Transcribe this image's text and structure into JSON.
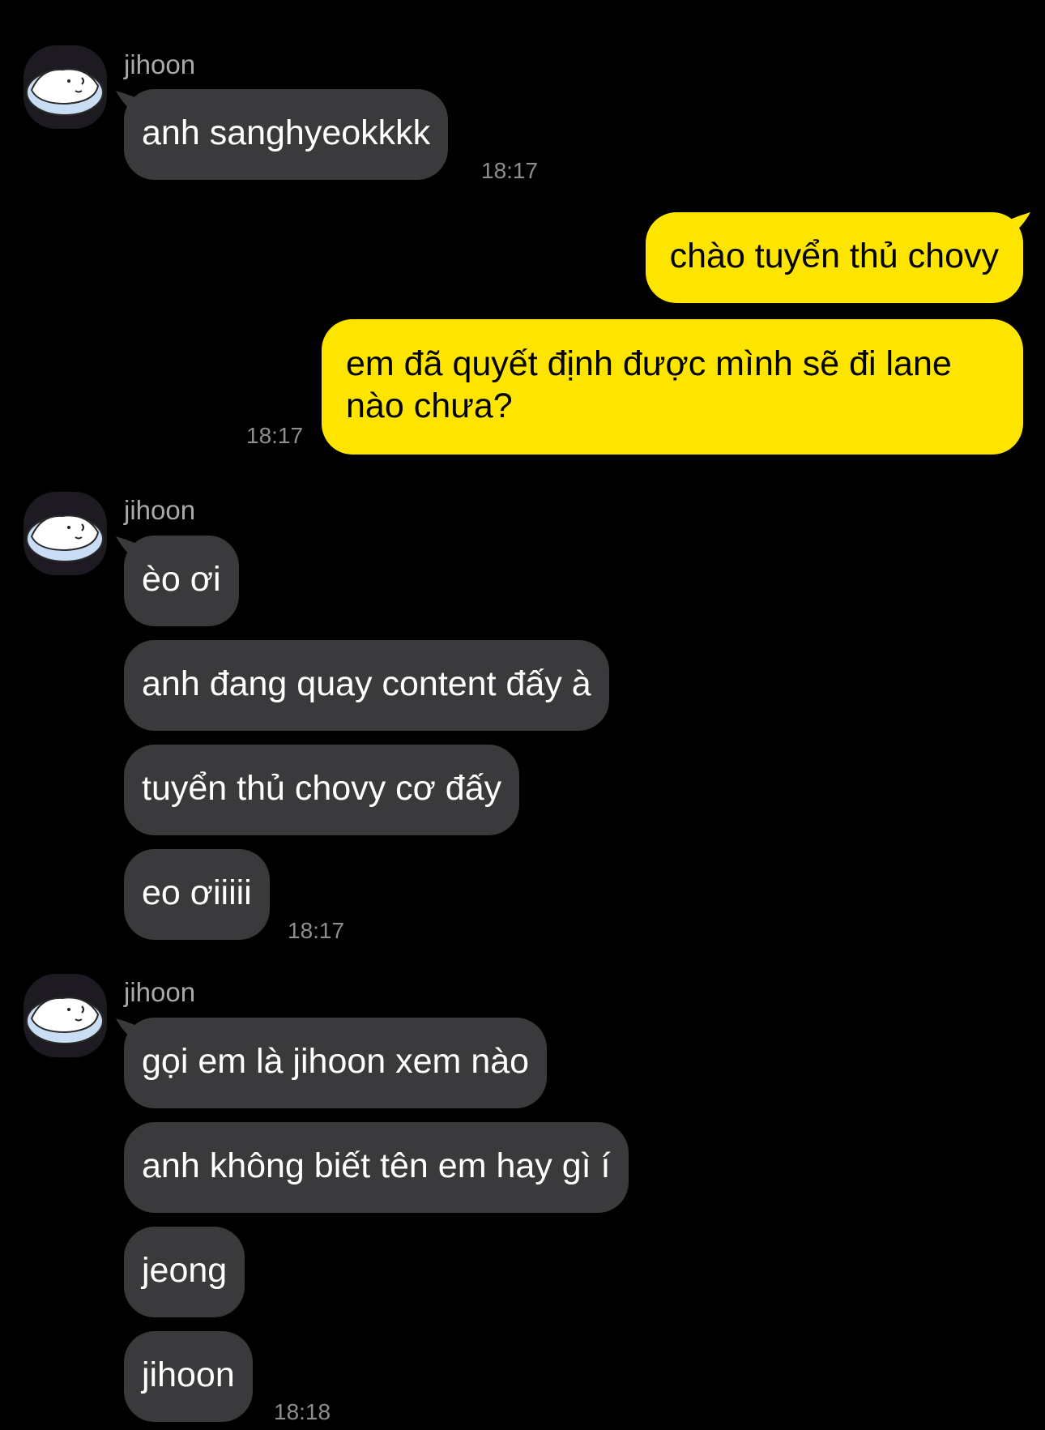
{
  "colors": {
    "background": "#000000",
    "incoming_bubble": "#3a3a3c",
    "outgoing_bubble": "#fee500",
    "sender_name": "#a9a9a9",
    "timestamp": "#8e8e8e"
  },
  "groups": [
    {
      "sender": "jihoon",
      "avatar_icon": "sleeping-blob-avatar-icon",
      "messages": [
        "anh sanghyeokkkk"
      ],
      "time": "18:17"
    },
    {
      "sender": "me",
      "messages": [
        "chào tuyển thủ chovy",
        "em đã quyết định được mình sẽ đi lane nào chưa?"
      ],
      "time": "18:17"
    },
    {
      "sender": "jihoon",
      "avatar_icon": "sleeping-blob-avatar-icon",
      "messages": [
        "èo ơi",
        "anh đang quay content đấy à",
        "tuyển thủ chovy cơ đấy",
        "eo ơiiiii"
      ],
      "time": "18:17"
    },
    {
      "sender": "jihoon",
      "avatar_icon": "sleeping-blob-avatar-icon",
      "messages": [
        "gọi em là jihoon xem nào",
        "anh không biết tên em hay gì í",
        "jeong",
        "jihoon"
      ],
      "time": "18:18"
    }
  ]
}
